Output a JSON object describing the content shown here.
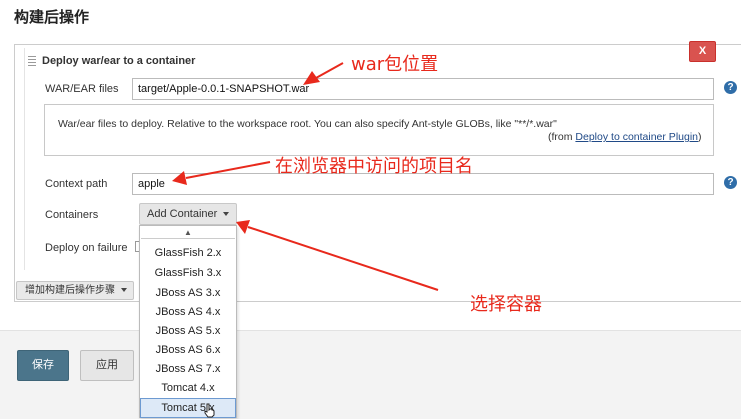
{
  "section": {
    "title": "构建后操作"
  },
  "step": {
    "title": "Deploy war/ear to a container",
    "delete_label": "X",
    "war_files": {
      "label": "WAR/EAR files",
      "value": "target/Apple-0.0.1-SNAPSHOT.war"
    },
    "help": {
      "text": "War/ear files to deploy. Relative to the workspace root. You can also specify Ant-style GLOBs, like \"**/*.war\"",
      "from_prefix": "(from ",
      "plugin_link": "Deploy to container Plugin",
      "from_suffix": ")"
    },
    "context_path": {
      "label": "Context path",
      "value": "apple"
    },
    "containers": {
      "label": "Containers",
      "add_button": "Add Container"
    },
    "deploy_on_failure": {
      "label": "Deploy on failure"
    }
  },
  "dropdown": {
    "scroll_up": "▲",
    "items": [
      "GlassFish 2.x",
      "GlassFish 3.x",
      "JBoss AS 3.x",
      "JBoss AS 4.x",
      "JBoss AS 5.x",
      "JBoss AS 6.x",
      "JBoss AS 7.x",
      "Tomcat 4.x",
      "Tomcat 5.x"
    ],
    "highlighted": "Tomcat 5.x"
  },
  "add_step_button": "增加构建后操作步骤",
  "buttons": {
    "save": "保存",
    "apply": "应用"
  },
  "help_icon": "?",
  "annotations": {
    "war": "war包位置",
    "context": "在浏览器中访问的项目名",
    "container": "选择容器"
  },
  "colors": {
    "annotation": "#e8291c",
    "delete": "#d9534f",
    "save": "#4b758b",
    "help": "#2f6da8"
  }
}
